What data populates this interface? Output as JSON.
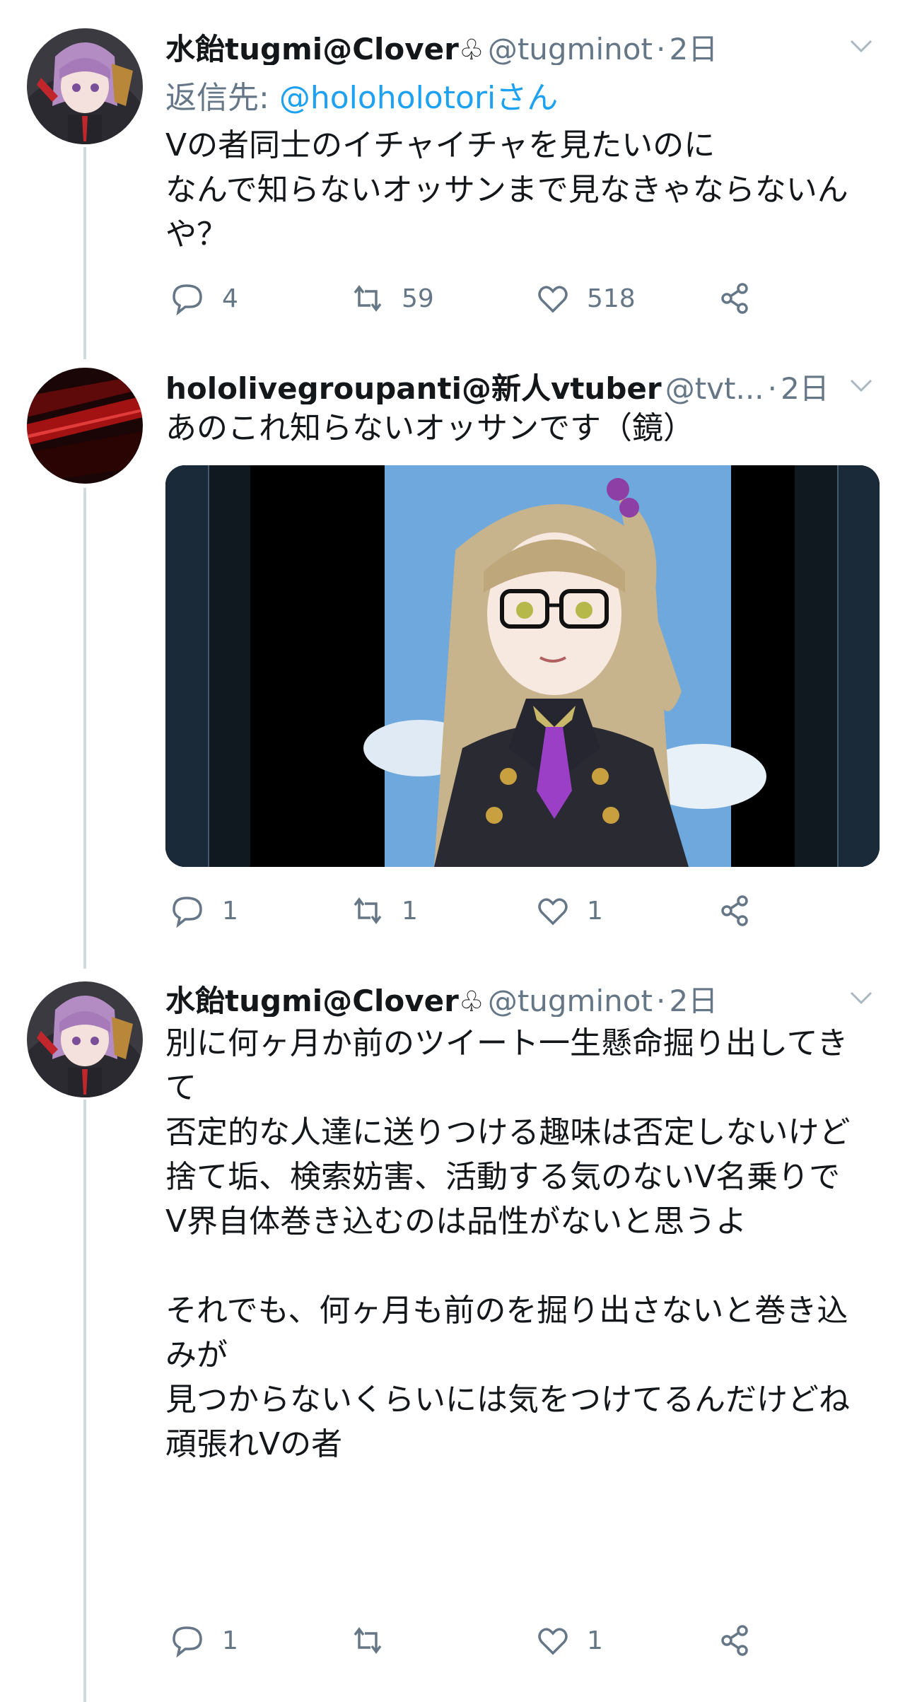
{
  "tweets": [
    {
      "name": "水飴tugmi@Clover",
      "handle": "@tugminot",
      "time": "2日",
      "reply_prefix": "返信先: ",
      "reply_to": "@holoholotoriさん",
      "text": "Vの者同士のイチャイチャを見たいのに\nなんで知らないオッサンまで見なきゃならないんや？",
      "replies": "4",
      "retweets": "59",
      "likes": "518",
      "avatar_icon": "anime-girl-avatar"
    },
    {
      "name": "hololivegroupanti@新人vtuber",
      "handle": "@tvt...",
      "time": "2日",
      "text": "あのこれ知らないオッサンです（鏡）",
      "replies": "1",
      "retweets": "1",
      "likes": "1",
      "avatar_icon": "red-abstract-avatar",
      "media": "anime-character-video-thumbnail"
    },
    {
      "name": "水飴tugmi@Clover",
      "handle": "@tugminot",
      "time": "2日",
      "text": "別に何ヶ月か前のツイート一生懸命掘り出してきて\n否定的な人達に送りつける趣味は否定しないけど\n捨て垢、検索妨害、活動する気のないV名乗りで\nV界自体巻き込むのは品性がないと思うよ\n\nそれでも、何ヶ月も前のを掘り出さないと巻き込みが\n見つからないくらいには気をつけてるんだけどね\n頑張れVの者",
      "replies": "1",
      "retweets": "",
      "likes": "1",
      "avatar_icon": "anime-girl-avatar"
    }
  ],
  "symbols": {
    "club": "♧",
    "dot": "·"
  },
  "colors": {
    "text": "#14171a",
    "secondary": "#657786",
    "link": "#1da1f2",
    "thread": "#cfd9de"
  }
}
